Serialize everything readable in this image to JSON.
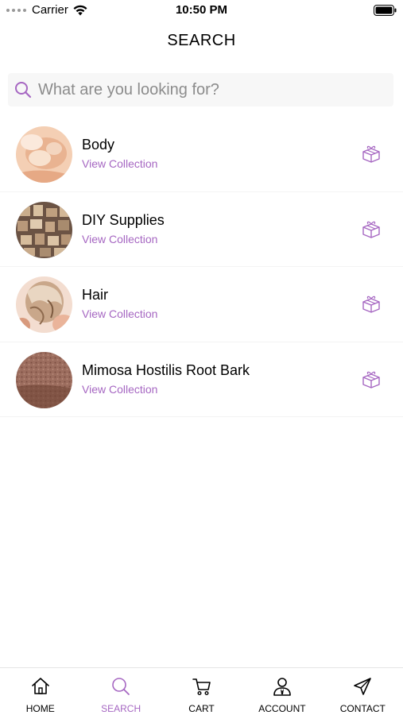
{
  "status_bar": {
    "carrier": "Carrier",
    "time": "10:50 PM"
  },
  "header": {
    "title": "SEARCH"
  },
  "search": {
    "placeholder": "What are you looking for?"
  },
  "collections": [
    {
      "title": "Body",
      "subtitle": "View Collection"
    },
    {
      "title": "DIY Supplies",
      "subtitle": "View Collection"
    },
    {
      "title": "Hair",
      "subtitle": "View Collection"
    },
    {
      "title": "Mimosa Hostilis Root Bark",
      "subtitle": "View Collection"
    }
  ],
  "nav": [
    {
      "label": "HOME",
      "icon": "home-icon"
    },
    {
      "label": "SEARCH",
      "icon": "search-icon",
      "active": true
    },
    {
      "label": "CART",
      "icon": "cart-icon"
    },
    {
      "label": "ACCOUNT",
      "icon": "account-icon"
    },
    {
      "label": "CONTACT",
      "icon": "send-icon"
    }
  ],
  "colors": {
    "accent": "#a667c2",
    "text": "#000000",
    "placeholder": "#8c8c8c"
  }
}
